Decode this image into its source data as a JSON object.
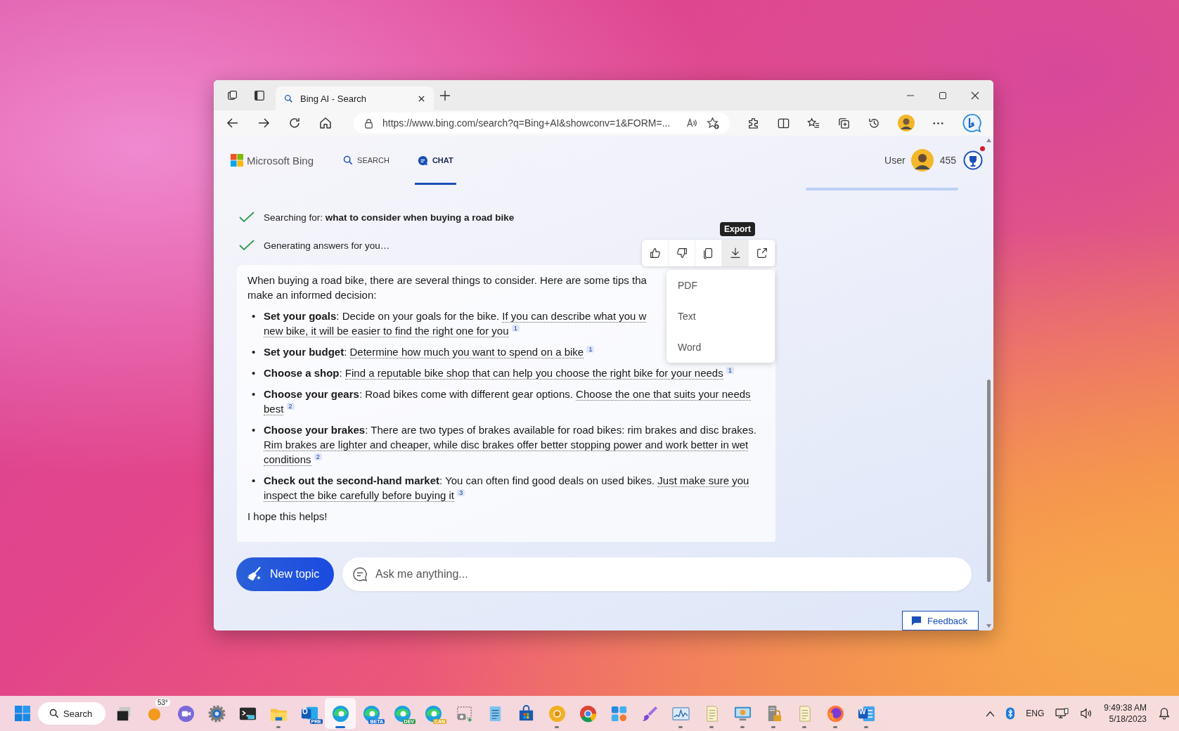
{
  "browser": {
    "tab": {
      "title": "Bing AI - Search",
      "selected": true
    },
    "address": "https://www.bing.com/search?q=Bing+AI&showconv=1&FORM=..."
  },
  "header": {
    "brand": "Microsoft Bing",
    "nav": [
      {
        "kind": "search",
        "label": "SEARCH",
        "selected": false
      },
      {
        "kind": "chat",
        "label": "CHAT",
        "selected": true
      }
    ],
    "user": "User",
    "points": "455",
    "notification": true
  },
  "status": [
    "Searching for: **what to consider when buying a road bike**",
    "Generating answers for you…"
  ],
  "message_actions": {
    "tooltip": "Export",
    "actions": [
      {
        "kind": "like",
        "selected": false
      },
      {
        "kind": "dislike",
        "selected": false
      },
      {
        "kind": "copy",
        "selected": false
      },
      {
        "kind": "export",
        "selected": true
      },
      {
        "kind": "share",
        "selected": false
      }
    ]
  },
  "export_menu": [
    "PDF",
    "Text",
    "Word"
  ],
  "answer": {
    "intro": [
      "When buying a road bike, there are several things to consider. Here are some tips tha",
      "make an informed decision:"
    ],
    "items": [
      {
        "title": "Set your goals",
        "text": ": Decide on your goals for the bike. ",
        "cited": [
          "If you can describe what you w",
          "new bike, it will be easier to find the right one for you"
        ],
        "citation": "1"
      },
      {
        "title": "Set your budget",
        "text": ": ",
        "cited": [
          "Determine how much you want to spend on a bike"
        ],
        "citation": "1"
      },
      {
        "title": "Choose a shop",
        "text": ": ",
        "cited": [
          "Find a reputable bike shop that can help you choose the right bike for your needs"
        ],
        "citation": "1"
      },
      {
        "title": "Choose your gears",
        "text": ": Road bikes come with different gear options. ",
        "cited": [
          "Choose the one that suits your needs best"
        ],
        "citation": "2"
      },
      {
        "title": "Choose your brakes",
        "text": ": There are two types of brakes available for road bikes: rim brakes and disc brakes. ",
        "cited": [
          "Rim brakes are lighter and cheaper, while disc brakes offer better stopping power and work better in wet conditions"
        ],
        "citation": "2"
      },
      {
        "title": "Check out the second-hand market",
        "text": ": You can often find good deals on used bikes. ",
        "cited": [
          "Just make sure you inspect the bike carefully before buying it"
        ],
        "citation": "3"
      }
    ],
    "bullet": "•",
    "closing": "I hope this helps!"
  },
  "composer": {
    "button": "New topic",
    "placeholder": "Ask me anything..."
  },
  "feedback": "Feedback",
  "taskbar": {
    "search": "Search",
    "apps": [
      {
        "kind": "taskview",
        "running": false,
        "selected": false
      },
      {
        "kind": "weather",
        "badge": "53°",
        "running": false,
        "selected": false
      },
      {
        "kind": "teams",
        "running": false,
        "selected": false
      },
      {
        "kind": "settings",
        "running": false,
        "selected": false
      },
      {
        "kind": "terminal",
        "running": false,
        "selected": false
      },
      {
        "kind": "explorer",
        "running": true,
        "selected": false
      },
      {
        "kind": "outlook",
        "letter": "O",
        "badge": "PRE",
        "color": "#0f5db8",
        "running": false,
        "selected": false
      },
      {
        "kind": "edge",
        "running": true,
        "selected": true
      },
      {
        "kind": "edge",
        "badge": "BETA",
        "color": "#1e6fd0",
        "running": false,
        "selected": false
      },
      {
        "kind": "edge",
        "badge": "DEV",
        "color": "#2e9a48",
        "running": false,
        "selected": false
      },
      {
        "kind": "edge",
        "badge": "CAN",
        "color": "#e0a81c",
        "running": false,
        "selected": false
      },
      {
        "kind": "snipping",
        "running": false,
        "selected": false
      },
      {
        "kind": "notepad",
        "running": false,
        "selected": false
      },
      {
        "kind": "store",
        "running": false,
        "selected": false
      },
      {
        "kind": "canary",
        "running": true,
        "selected": false
      },
      {
        "kind": "chrome",
        "running": false,
        "selected": false
      },
      {
        "kind": "tiles",
        "running": false,
        "selected": false
      },
      {
        "kind": "brush",
        "running": false,
        "selected": false
      },
      {
        "kind": "perfmon",
        "running": true,
        "selected": false
      },
      {
        "kind": "paper",
        "running": true,
        "selected": false
      },
      {
        "kind": "remote",
        "running": true,
        "selected": false
      },
      {
        "kind": "server",
        "running": true,
        "selected": false
      },
      {
        "kind": "paper",
        "running": true,
        "selected": false
      },
      {
        "kind": "firefox",
        "running": true,
        "selected": false
      },
      {
        "kind": "word",
        "letter": "W",
        "running": true,
        "selected": false
      }
    ],
    "tray": {
      "language": "ENG",
      "time": "9:49:38 AM",
      "date": "5/18/2023"
    }
  }
}
